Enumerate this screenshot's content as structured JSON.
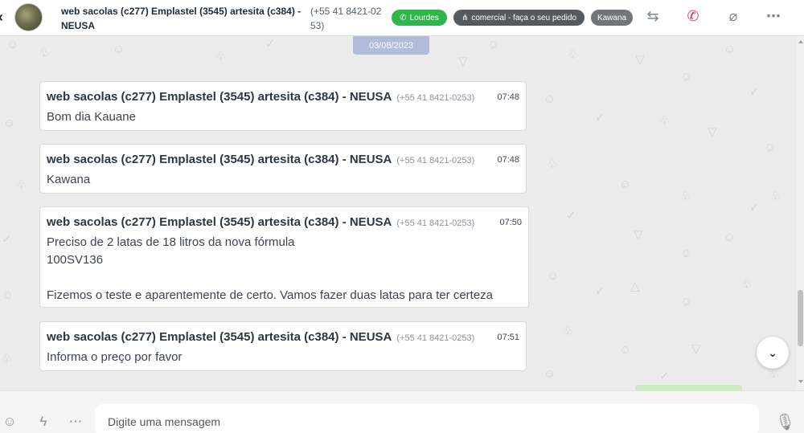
{
  "header": {
    "contact_name": "web sacolas (c277) Emplastel (3545) artesita (c384) - NEUSA",
    "contact_phone": "(+55 41 8421-0253)",
    "tags": [
      {
        "label": "Lourdes",
        "icon": "whatsapp-icon",
        "color": "#2fb54a"
      },
      {
        "label": "comercial - faça o seu pedido",
        "icon": "department-icon",
        "color": "#555a5f"
      },
      {
        "label": "Kawana",
        "color": "#6f757b"
      }
    ]
  },
  "chat": {
    "date_badge": "03/08/2023",
    "messages": [
      {
        "sender": "web sacolas (c277) Emplastel (3545) artesita (c384) - NEUSA",
        "phone": "(+55 41 8421-0253)",
        "time": "07:48",
        "text": "Bom dia Kauane"
      },
      {
        "sender": "web sacolas (c277) Emplastel (3545) artesita (c384) - NEUSA",
        "phone": "(+55 41 8421-0253)",
        "time": "07:48",
        "text": "Kawana"
      },
      {
        "sender": "web sacolas (c277) Emplastel (3545) artesita (c384) - NEUSA",
        "phone": "(+55 41 8421-0253)",
        "time": "07:50",
        "text": "Preciso de 2 latas de 18 litros da nova fórmula\n100SV136\n\nFizemos o teste e aparentemente de certo. Vamos fazer duas latas para ter certeza"
      },
      {
        "sender": "web sacolas (c277) Emplastel (3545) artesita (c384) - NEUSA",
        "phone": "(+55 41 8421-0253)",
        "time": "07:51",
        "text": "Informa o preço por favor"
      }
    ]
  },
  "footer": {
    "input_placeholder": "Digite uma mensagem"
  },
  "colors": {
    "accent_green": "#2fb54a",
    "call_red": "#d9365c",
    "date_badge": "#a9b8d9"
  }
}
